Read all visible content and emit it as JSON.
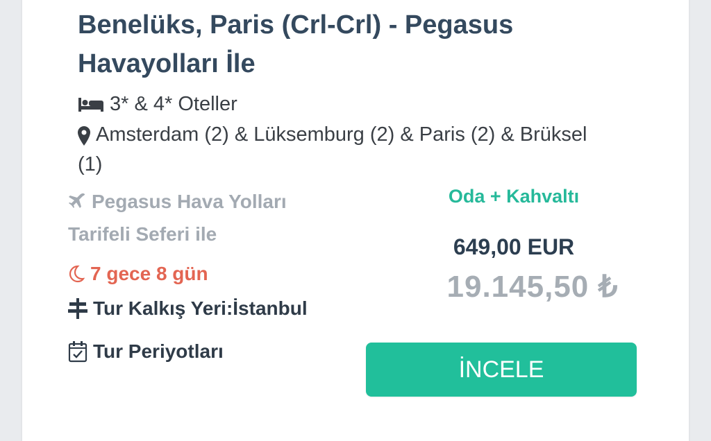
{
  "tour": {
    "title": "Benelüks, Paris (Crl-Crl) - Pegasus Havayolları İle",
    "hotels": "3* & 4* Oteller",
    "cities_line1": "Amsterdam (2) & Lüksemburg (2) & Paris (2) & Brüksel",
    "cities_line2": "(1)",
    "airline_line1": "Pegasus Hava Yolları",
    "airline_line2": "Tarifeli Seferi ile",
    "duration": "7 gece 8 gün",
    "departure": "Tur Kalkış Yeri:İstanbul",
    "periods": "Tur Periyotları",
    "board_type": "Oda + Kahvaltı",
    "price_eur": "649,00 EUR",
    "price_try": "19.145,50 ₺",
    "button_label": "İNCELE"
  },
  "icons": {
    "hotel": "bed-icon",
    "location": "map-pin-icon",
    "airline": "plane-icon",
    "duration": "moon-icon",
    "departure": "signpost-icon",
    "periods": "calendar-check-icon"
  },
  "colors": {
    "title": "#34495e",
    "accent": "#21bf9b",
    "board": "#26b99a",
    "duration": "#e36552",
    "muted": "#a3aab2"
  }
}
